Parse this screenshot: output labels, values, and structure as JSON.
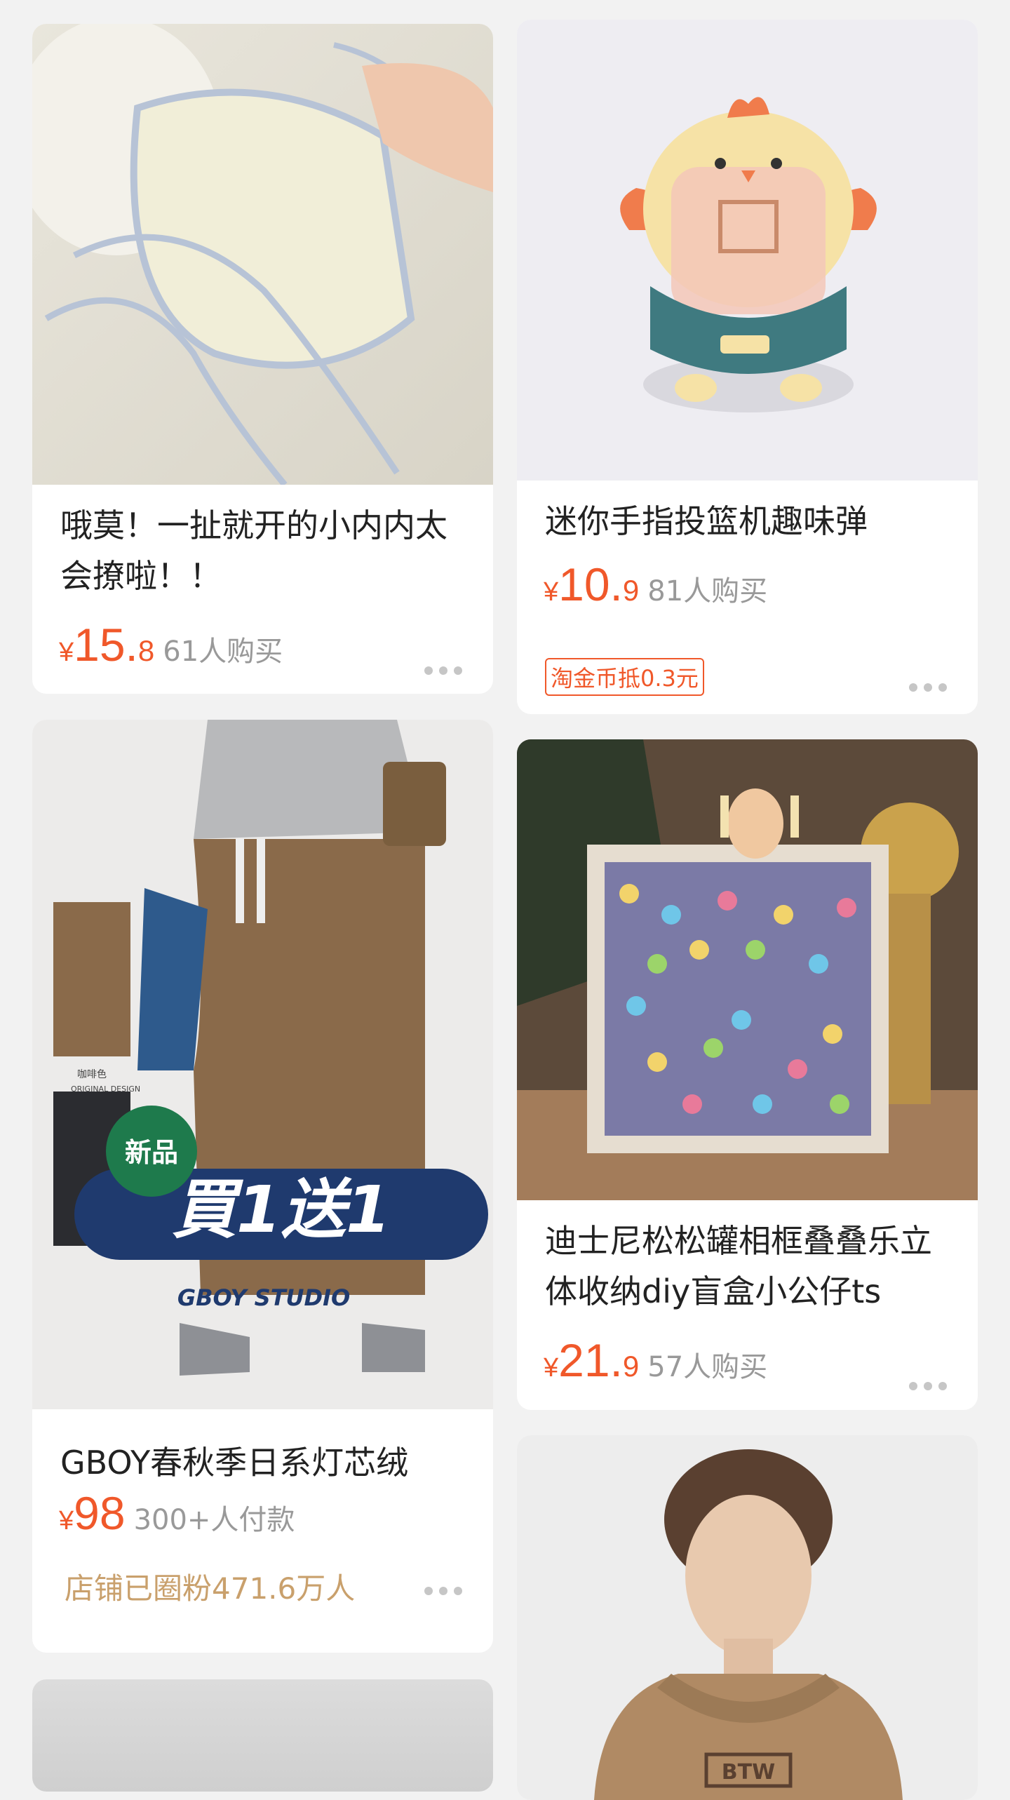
{
  "products": [
    {
      "title": "哦莫！一扯就开的小内内太会撩啦！！",
      "currency": "¥",
      "price_int": "15.",
      "price_dec": "8",
      "sales": "61人购买"
    },
    {
      "title": "迷你手指投篮机趣味弹",
      "currency": "¥",
      "price_int": "10.",
      "price_dec": "9",
      "sales": "81人购买",
      "tag": "淘金币抵0.3元"
    },
    {
      "title": "GBOY春秋季日系灯芯绒",
      "currency": "¥",
      "price_int": "98",
      "price_dec": "",
      "sales": "300+人付款",
      "fans": "店铺已圈粉471.6万人",
      "image_text": {
        "badge": "新品",
        "promo": "買1送1",
        "brand": "GBOY STUDIO",
        "swatch_1": "咖啡色",
        "swatch_1_sub": "ORIGINAL DESIGN"
      }
    },
    {
      "title": "迪士尼松松罐相框叠叠乐立体收纳diy盲盒小公仔ts",
      "currency": "¥",
      "price_int": "21.",
      "price_dec": "9",
      "sales": "57人购买"
    },
    {
      "image_text": {
        "logo": "BTW"
      }
    }
  ],
  "colors": {
    "accent": "#f0582a",
    "fans": "#c9a06c",
    "background": "#f2f2f2"
  },
  "icons": [
    "more-dots-icon"
  ]
}
